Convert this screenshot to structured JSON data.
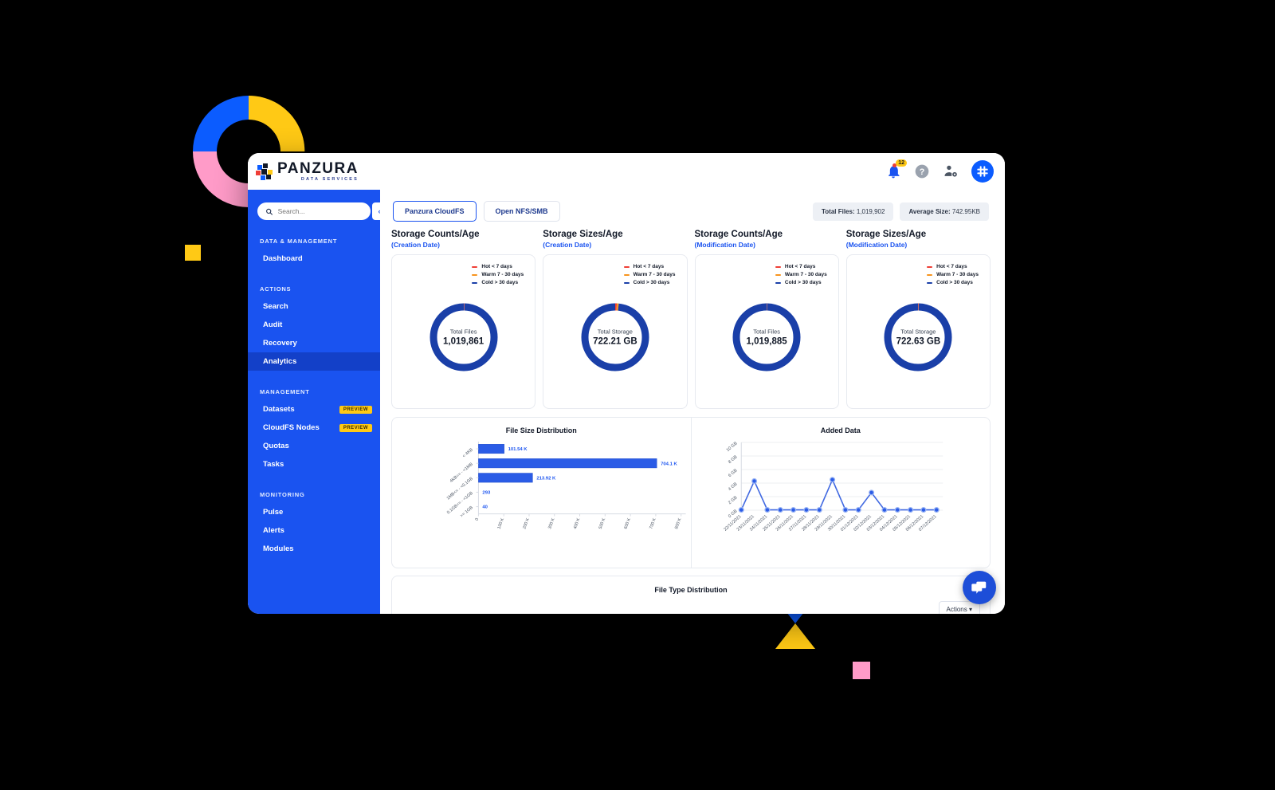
{
  "theme": {
    "brand_blue": "#1A53F0",
    "deep_blue": "#1A3FA8",
    "yellow": "#FFC915",
    "pink": "#FF9BC8",
    "red": "#EF3E36",
    "orange": "#F7941E"
  },
  "brand": {
    "name": "PANZURA",
    "tagline": "DATA SERVICES"
  },
  "header": {
    "notification_count": "12",
    "icons": [
      "bell-icon",
      "help-icon",
      "user-settings-icon",
      "apps-grid-icon"
    ]
  },
  "sidebar": {
    "search": {
      "placeholder": "Search...",
      "value": ""
    },
    "collapse_label": "‹",
    "sections": [
      {
        "title": "DATA & MANAGEMENT",
        "items": [
          {
            "label": "Dashboard",
            "tag": "",
            "active": false
          }
        ]
      },
      {
        "title": "ACTIONS",
        "items": [
          {
            "label": "Search",
            "tag": "",
            "active": false
          },
          {
            "label": "Audit",
            "tag": "",
            "active": false
          },
          {
            "label": "Recovery",
            "tag": "",
            "active": false
          },
          {
            "label": "Analytics",
            "tag": "",
            "active": true
          }
        ]
      },
      {
        "title": "MANAGEMENT",
        "items": [
          {
            "label": "Datasets",
            "tag": "PREVIEW",
            "active": false
          },
          {
            "label": "CloudFS Nodes",
            "tag": "PREVIEW",
            "active": false
          },
          {
            "label": "Quotas",
            "tag": "",
            "active": false
          },
          {
            "label": "Tasks",
            "tag": "",
            "active": false
          }
        ]
      },
      {
        "title": "MONITORING",
        "items": [
          {
            "label": "Pulse",
            "tag": "",
            "active": false
          },
          {
            "label": "Alerts",
            "tag": "",
            "active": false
          },
          {
            "label": "Modules",
            "tag": "",
            "active": false
          }
        ]
      }
    ]
  },
  "tabs": [
    {
      "label": "Panzura CloudFS",
      "active": true
    },
    {
      "label": "Open NFS/SMB",
      "active": false
    }
  ],
  "stats": [
    {
      "label": "Total Files:",
      "value": "1,019,902"
    },
    {
      "label": "Average Size:",
      "value": "742.95KB"
    }
  ],
  "legend": [
    {
      "label": "Hot < 7 days",
      "color": "#EF3E36"
    },
    {
      "label": "Warm 7 - 30 days",
      "color": "#F7941E"
    },
    {
      "label": "Cold > 30 days",
      "color": "#1A3FA8"
    }
  ],
  "donuts": [
    {
      "title": "Storage Counts/Age",
      "subtitle": "(Creation Date)",
      "center_label": "Total Files",
      "center_value": "1,019,861",
      "hot_pct": 0.2,
      "warm_pct": 0.1,
      "cold_pct": 99.7
    },
    {
      "title": "Storage Sizes/Age",
      "subtitle": "(Creation Date)",
      "center_label": "Total Storage",
      "center_value": "722.21 GB",
      "hot_pct": 0.8,
      "warm_pct": 0.9,
      "cold_pct": 98.3
    },
    {
      "title": "Storage Counts/Age",
      "subtitle": "(Modification Date)",
      "center_label": "Total Files",
      "center_value": "1,019,885",
      "hot_pct": 0.15,
      "warm_pct": 0.1,
      "cold_pct": 99.75
    },
    {
      "title": "Storage Sizes/Age",
      "subtitle": "(Modification Date)",
      "center_label": "Total Storage",
      "center_value": "722.63 GB",
      "hot_pct": 0.2,
      "warm_pct": 0.15,
      "cold_pct": 99.65
    }
  ],
  "bottom_card": {
    "title": "File Type Distribution",
    "actions_label": "Actions ▾"
  },
  "chat": {
    "icon": "chat-bubble-icon"
  },
  "chart_data": [
    {
      "type": "bar",
      "orientation": "horizontal",
      "title": "File Size Distribution",
      "categories": [
        "< 4KB",
        "4KB<= - <1MB",
        "1MB<= - <0.1GB",
        "0.1GB<= - <1GB",
        ">= 1GB"
      ],
      "values": [
        101540,
        704100,
        213920,
        293,
        40
      ],
      "data_labels": [
        "101.54 K",
        "704.1 K",
        "213.92 K",
        "293",
        "40"
      ],
      "xlabel": "",
      "ylabel": "",
      "xlim": [
        0,
        800000
      ],
      "xticks": [
        0,
        100000,
        200000,
        300000,
        400000,
        500000,
        600000,
        700000,
        800000
      ],
      "xticklabels": [
        "0",
        "100 K",
        "200 K",
        "300 K",
        "400 K",
        "500 K",
        "600 K",
        "700 K",
        "800 K"
      ],
      "bar_color": "#2B5CE6",
      "grid": false,
      "legend": "none"
    },
    {
      "type": "line",
      "title": "Added Data",
      "x": [
        "22/11/2021",
        "23/11/2021",
        "24/11/2021",
        "25/11/2021",
        "26/11/2021",
        "27/11/2021",
        "28/11/2021",
        "29/11/2021",
        "30/11/2021",
        "01/12/2021",
        "02/12/2021",
        "03/12/2021",
        "04/12/2021",
        "05/12/2021",
        "06/12/2021",
        "07/12/2021"
      ],
      "values": [
        0.05,
        4.3,
        0.05,
        0.05,
        0.05,
        0.05,
        0.05,
        4.5,
        0.05,
        0.05,
        2.6,
        0.05,
        0.05,
        0.05,
        0.05,
        0.05
      ],
      "xlabel": "",
      "ylabel": "",
      "ylim": [
        0,
        10
      ],
      "yticks": [
        0,
        2,
        4,
        6,
        8,
        10
      ],
      "yticklabels": [
        "0 GB",
        "2 GB",
        "4 GB",
        "6 GB",
        "8 GB",
        "10 GB"
      ],
      "line_color": "#4169E1",
      "marker_color": "#2B5CE6",
      "grid": true,
      "legend": "none"
    }
  ]
}
